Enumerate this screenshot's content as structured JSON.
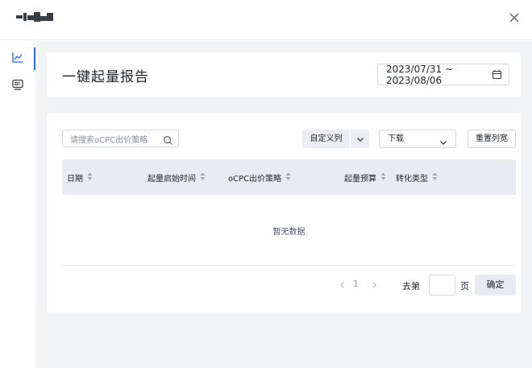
{
  "header": {
    "title": "一键起量报告",
    "date_range": "2023/07/31 ~ 2023/08/06"
  },
  "sidebar": {
    "items": [
      {
        "icon": "line-chart-icon",
        "active": true
      },
      {
        "icon": "report-icon",
        "active": false
      }
    ]
  },
  "toolbar": {
    "search_placeholder": "请搜索oCPC出价策略",
    "custom_columns_label": "自定义列",
    "download_label": "下载",
    "reset_columns_label": "重置列宽"
  },
  "table": {
    "columns": [
      "日期",
      "起量启始时间",
      "oCPC出价策略",
      "起量预算",
      "转化类型"
    ],
    "empty_text": "暂无数据"
  },
  "pagination": {
    "current_page": "1",
    "goto_label": "去第",
    "page_label": "页",
    "confirm_label": "确定"
  },
  "colors": {
    "accent": "#2468f2",
    "background": "#f2f3f5",
    "table_header": "#e8ebf0"
  }
}
